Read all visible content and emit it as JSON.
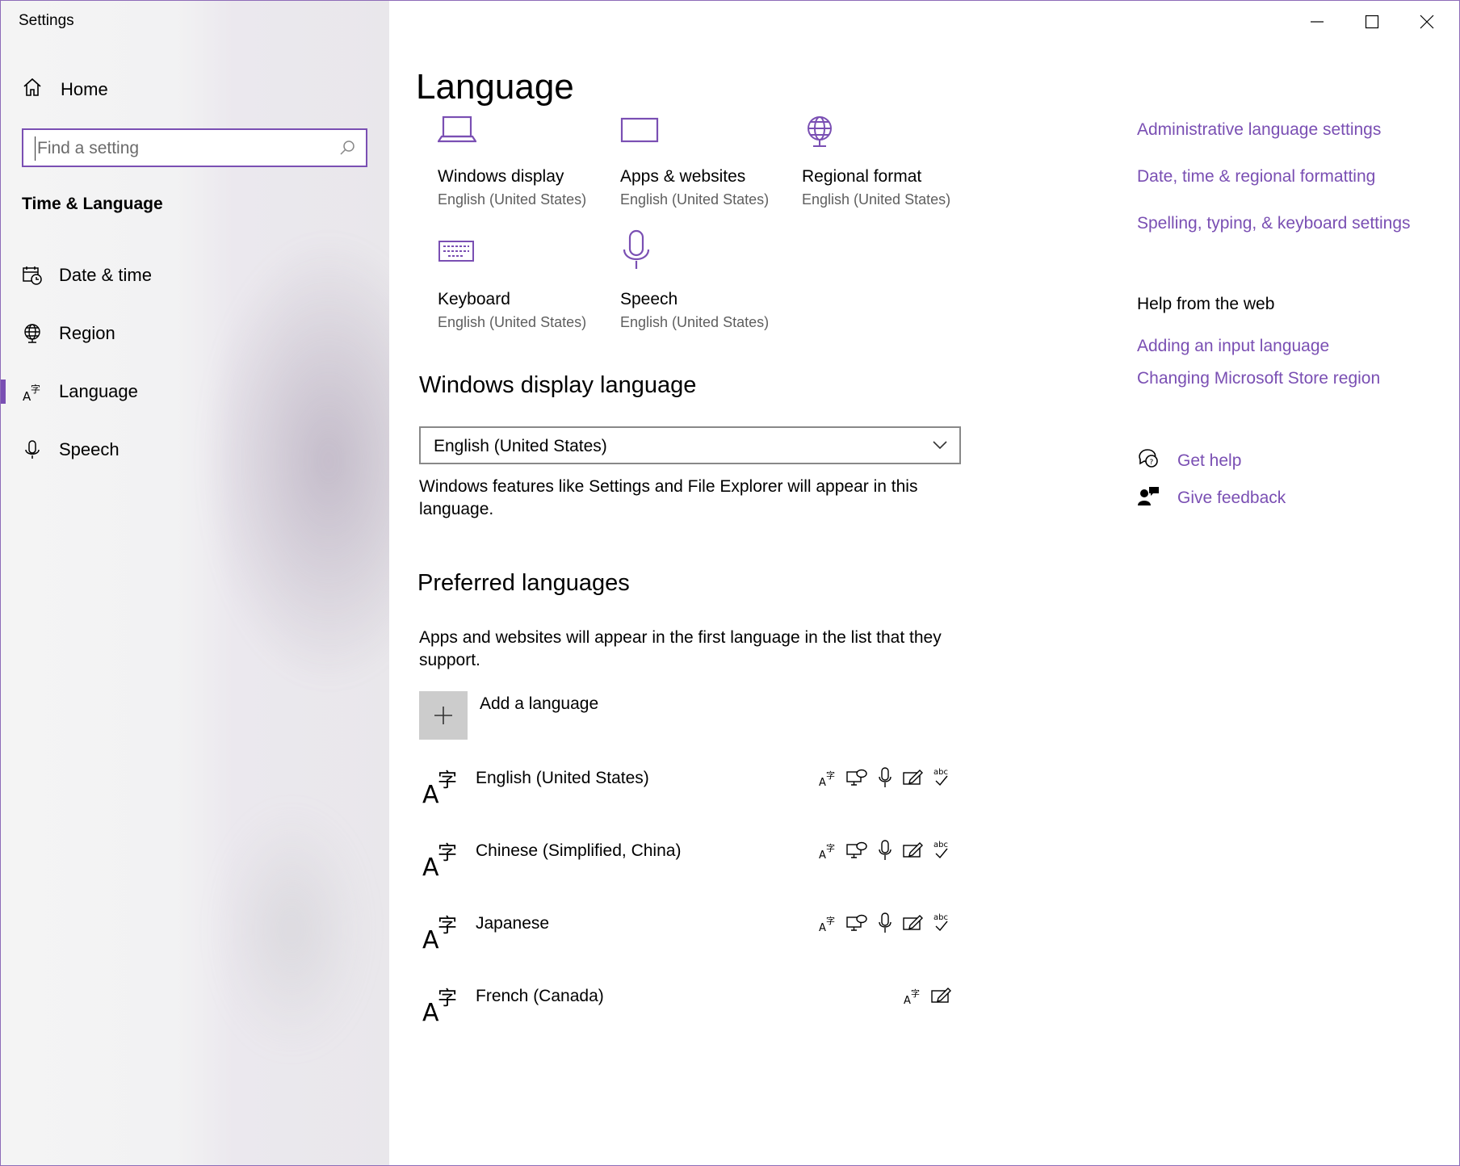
{
  "window": {
    "title": "Settings"
  },
  "sidebar": {
    "home_label": "Home",
    "search_placeholder": "Find a setting",
    "section_title": "Time & Language",
    "items": [
      {
        "label": "Date & time",
        "icon": "calendar-clock-icon"
      },
      {
        "label": "Region",
        "icon": "globe-icon"
      },
      {
        "label": "Language",
        "icon": "language-icon",
        "active": true
      },
      {
        "label": "Speech",
        "icon": "microphone-icon"
      }
    ]
  },
  "main": {
    "title": "Language",
    "tiles": [
      {
        "name": "Windows display",
        "value": "English (United States)",
        "icon": "laptop-icon"
      },
      {
        "name": "Apps & websites",
        "value": "English (United States)",
        "icon": "window-icon"
      },
      {
        "name": "Regional format",
        "value": "English (United States)",
        "icon": "globe-icon"
      },
      {
        "name": "Keyboard",
        "value": "English (United States)",
        "icon": "keyboard-icon"
      },
      {
        "name": "Speech",
        "value": "English (United States)",
        "icon": "microphone-icon"
      }
    ],
    "display_language": {
      "heading": "Windows display language",
      "selected": "English (United States)",
      "description": "Windows features like Settings and File Explorer will appear in this language."
    },
    "preferred": {
      "heading": "Preferred languages",
      "description": "Apps and websites will appear in the first language in the list that they support.",
      "add_label": "Add a language",
      "languages": [
        {
          "name": "English (United States)",
          "features": [
            "display-language",
            "text-to-speech",
            "speech-recognition",
            "handwriting",
            "spell-check"
          ]
        },
        {
          "name": "Chinese (Simplified, China)",
          "features": [
            "display-language",
            "text-to-speech",
            "speech-recognition",
            "handwriting",
            "spell-check"
          ]
        },
        {
          "name": "Japanese",
          "features": [
            "display-language",
            "text-to-speech",
            "speech-recognition",
            "handwriting",
            "spell-check"
          ]
        },
        {
          "name": "French (Canada)",
          "features": [
            "display-language",
            "handwriting"
          ]
        }
      ]
    }
  },
  "related": {
    "links": [
      "Administrative language settings",
      "Date, time & regional formatting",
      "Spelling, typing, & keyboard settings"
    ],
    "help_heading": "Help from the web",
    "help_links": [
      "Adding an input language",
      "Changing Microsoft Store region"
    ],
    "get_help": "Get help",
    "give_feedback": "Give feedback"
  },
  "colors": {
    "accent": "#7a4fb3",
    "sidebar_bg": "#f2f2f2",
    "secondary_text": "#5e5e5e"
  },
  "feature_glyph": {
    "abc": "abc"
  }
}
